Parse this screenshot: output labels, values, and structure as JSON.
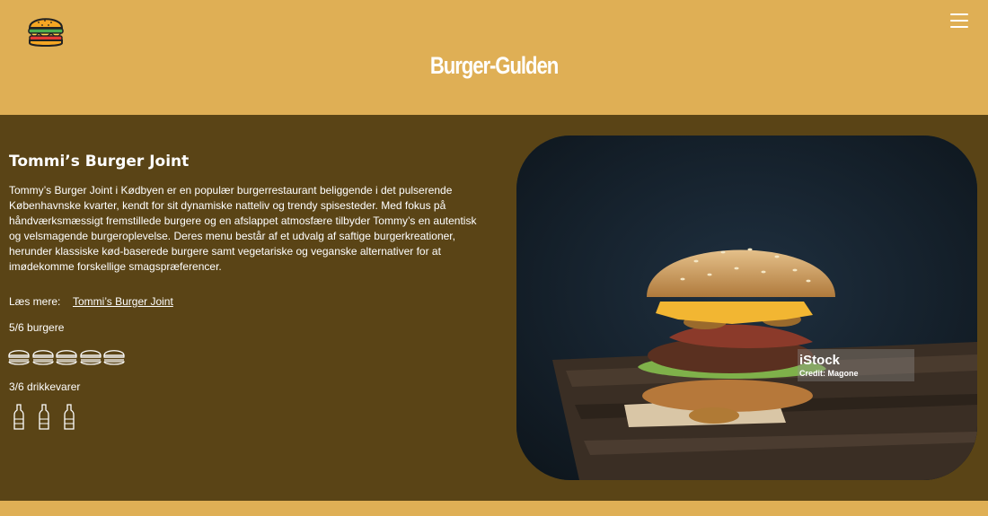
{
  "header": {
    "title": "Burger-Gulden",
    "logo_icon": "burger-logo-icon",
    "menu_icon": "hamburger-menu-icon"
  },
  "restaurant": {
    "name": "Tommi’s Burger Joint",
    "description": "Tommy’s Burger Joint i Kødbyen er en populær burgerrestaurant beliggende i det pulserende Københavnske kvarter, kendt for sit dynamiske natteliv og trendy spisesteder. Med fokus på håndværksmæssigt fremstillede burgere og en afslappet atmosfære tilbyder Tommy’s en autentisk og velsmagende burgeroplevelse. Deres menu består af et udvalg af saftige burgerkreationer, herunder klassiske kød-baserede burgere samt vegetariske og veganske alternativer for at imødekomme forskellige smagspræferencer.",
    "read_more_label": "Læs mere:",
    "read_more_link": "Tommi’s Burger Joint"
  },
  "ratings": {
    "burger_label": "5/6 burgere",
    "burger_score": 5,
    "burger_max": 6,
    "drink_label": "3/6 drikkevarer",
    "drink_score": 3,
    "drink_max": 6
  },
  "photo": {
    "watermark_brand": "iStock",
    "watermark_credit": "Credit: Magone"
  },
  "colors": {
    "header_bg": "#dfaf55",
    "content_bg": "#5a4416",
    "text": "#ffffff"
  }
}
